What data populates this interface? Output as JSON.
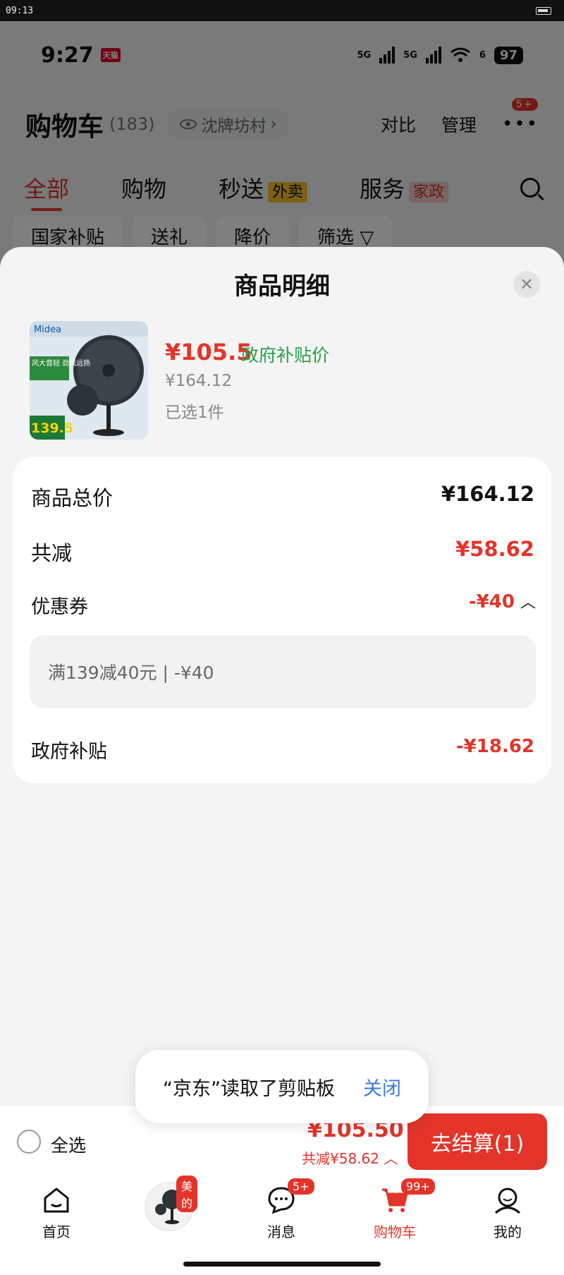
{
  "sysbar": {
    "time": "09:13"
  },
  "status": {
    "time": "9:27",
    "app_badge": "天猫",
    "net1": "5G",
    "net2": "5G",
    "wifi": "6",
    "battery": "97"
  },
  "header": {
    "title": "购物车",
    "count": "(183)",
    "store": "沈牌坊村",
    "compare": "对比",
    "manage": "管理",
    "dots_badge": "5+"
  },
  "tabs": [
    {
      "label": "全部"
    },
    {
      "label": "购物"
    },
    {
      "label": "秒送",
      "tag": "外卖"
    },
    {
      "label": "服务",
      "tag": "家政"
    }
  ],
  "chips": [
    "国家补贴",
    "送礼",
    "降价",
    "筛选"
  ],
  "sheet": {
    "title": "商品明细"
  },
  "product": {
    "brand": "Midea",
    "img_tag": "风大音轻 劲风远扬",
    "img_price": "139.5",
    "price": "¥105.5",
    "price_label": "政府补贴价",
    "original": "¥164.12",
    "selected": "已选1件"
  },
  "detail": {
    "total_label": "商品总价",
    "total_value": "¥164.12",
    "discount_label": "共减",
    "discount_value": "¥58.62",
    "coupon_label": "优惠券",
    "coupon_value": "-¥40",
    "coupon_text": "满139减40元 | -¥40",
    "subsidy_label": "政府补贴",
    "subsidy_value": "-¥18.62"
  },
  "toast": {
    "text": "“京东”读取了剪贴板",
    "close": "关闭"
  },
  "bottom": {
    "select_all": "全选",
    "total": "¥105.50",
    "saved": "共减¥58.62",
    "checkout": "去结算(1)"
  },
  "nav": [
    {
      "label": "首页",
      "icon": "home-icon"
    },
    {
      "label": "",
      "icon": "fan-product-icon",
      "badge": "美的"
    },
    {
      "label": "消息",
      "icon": "message-icon",
      "badge": "5+"
    },
    {
      "label": "购物车",
      "icon": "cart-icon",
      "badge": "99+"
    },
    {
      "label": "我的",
      "icon": "user-icon"
    }
  ],
  "colors": {
    "accent": "#e4342a",
    "green": "#27a048",
    "link": "#3d7bd8"
  }
}
